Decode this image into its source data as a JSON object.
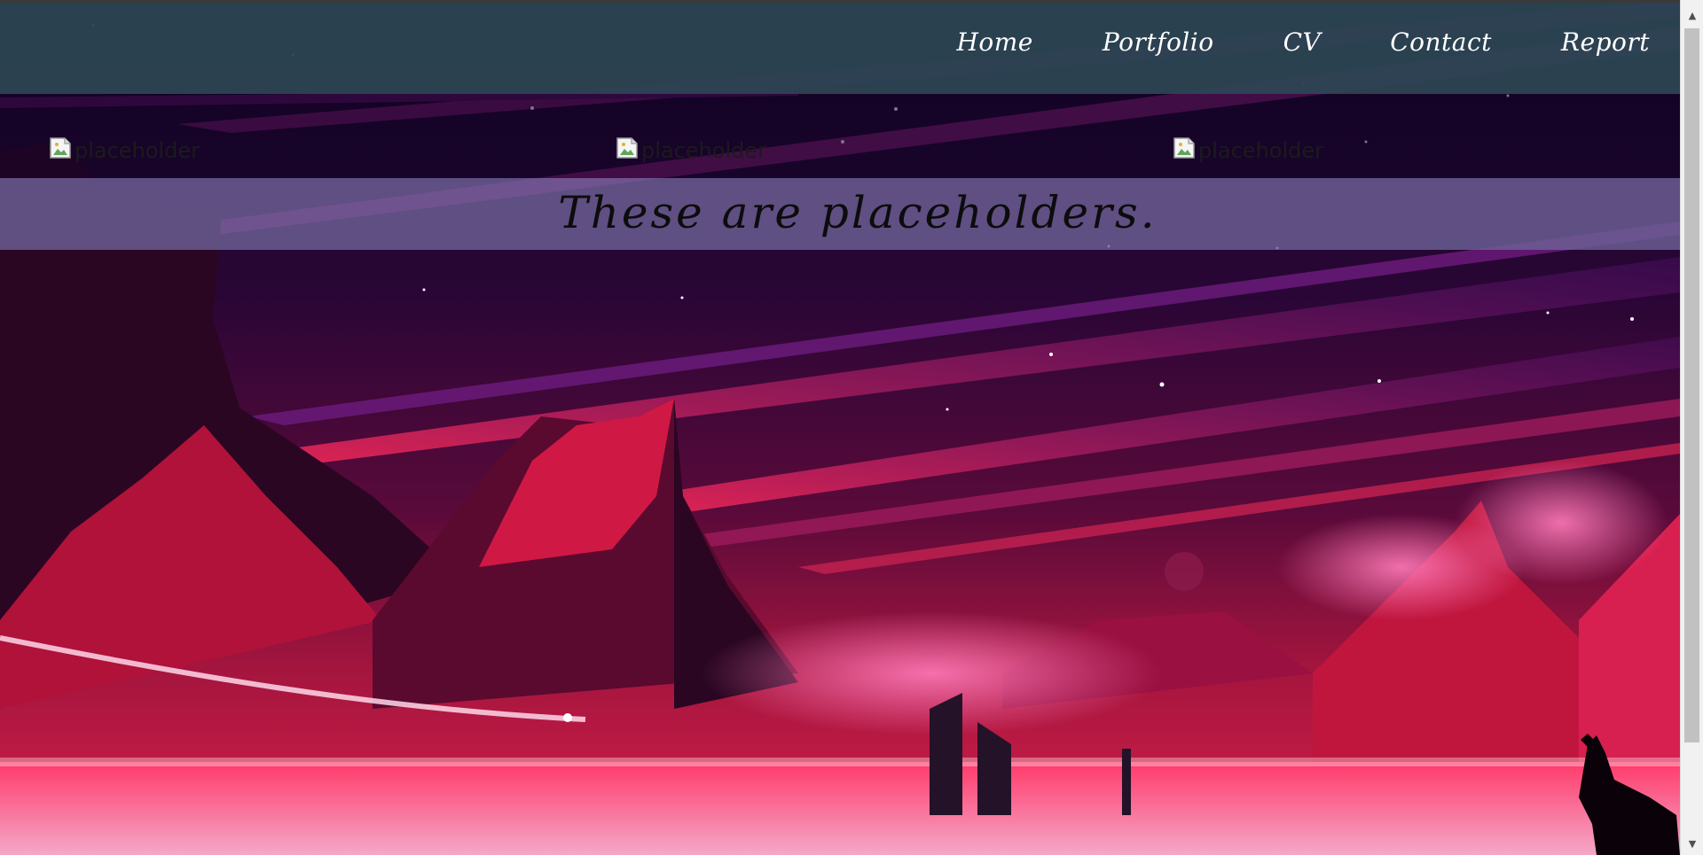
{
  "nav": {
    "links": [
      "Home",
      "Portfolio",
      "CV",
      "Contact",
      "Report"
    ]
  },
  "placeholders": {
    "alt_texts": [
      "placeholder",
      "placeholder",
      "placeholder"
    ]
  },
  "banner": {
    "text": "These are placeholders."
  },
  "colors": {
    "navbar": "#2c4452",
    "banner": "#6c6096",
    "sky_dark": "#1a0626",
    "mountain_red": "#c8163e"
  },
  "icons": {
    "broken_image": "broken-image-icon",
    "scroll_up": "scroll-up-arrow-icon",
    "scroll_down": "scroll-down-arrow-icon"
  }
}
